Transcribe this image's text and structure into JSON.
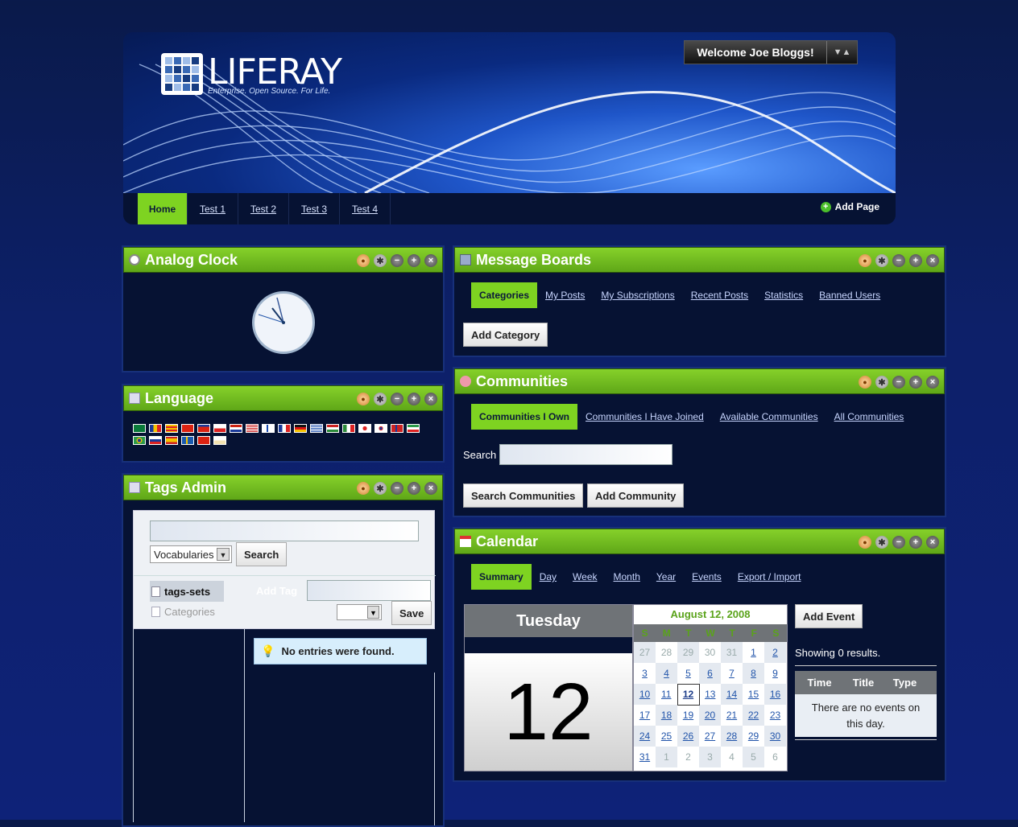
{
  "header": {
    "logo_text": "LIFERAY",
    "logo_tagline": "Enterprise. Open Source. For Life.",
    "welcome": "Welcome Joe Bloggs!"
  },
  "nav": {
    "items": [
      "Home",
      "Test 1",
      "Test 2",
      "Test 3",
      "Test 4"
    ],
    "add_page": "Add Page"
  },
  "clock": {
    "title": "Analog Clock"
  },
  "language": {
    "title": "Language"
  },
  "tags_admin": {
    "title": "Tags Admin",
    "vocab_select": "Vocabularies",
    "search_button": "Search",
    "tag_sets": "tags-sets",
    "categories": "Categories",
    "add_tag_label": "Add Tag",
    "save_button": "Save",
    "no_entries": "No entries were found."
  },
  "message_boards": {
    "title": "Message Boards",
    "tabs": [
      "Categories",
      "My Posts",
      "My Subscriptions",
      "Recent Posts",
      "Statistics",
      "Banned Users"
    ],
    "add_button": "Add Category"
  },
  "communities": {
    "title": "Communities",
    "tabs": [
      "Communities I Own",
      "Communities I Have Joined",
      "Available Communities",
      "All Communities"
    ],
    "search_label": "Search",
    "search_button": "Search Communities",
    "add_button": "Add Community"
  },
  "calendar": {
    "title": "Calendar",
    "tabs": [
      "Summary",
      "Day",
      "Week",
      "Month",
      "Year",
      "Events",
      "Export / Import"
    ],
    "weekday": "Tuesday",
    "day_number": "12",
    "month_title": "August 12, 2008",
    "dow": [
      "S",
      "M",
      "T",
      "W",
      "T",
      "F",
      "S"
    ],
    "add_event": "Add Event",
    "showing": "Showing 0 results.",
    "columns": [
      "Time",
      "Title",
      "Type"
    ],
    "no_events": "There are no events on this day.",
    "weeks": [
      [
        "27",
        "28",
        "29",
        "30",
        "31",
        "1",
        "2"
      ],
      [
        "3",
        "4",
        "5",
        "6",
        "7",
        "8",
        "9"
      ],
      [
        "10",
        "11",
        "12",
        "13",
        "14",
        "15",
        "16"
      ],
      [
        "17",
        "18",
        "19",
        "20",
        "21",
        "22",
        "23"
      ],
      [
        "24",
        "25",
        "26",
        "27",
        "28",
        "29",
        "30"
      ],
      [
        "31",
        "1",
        "2",
        "3",
        "4",
        "5",
        "6"
      ]
    ]
  },
  "colors": {
    "accent_green": "#7ed321",
    "page_bg": "#0d2069",
    "portlet_bg": "#061233"
  }
}
